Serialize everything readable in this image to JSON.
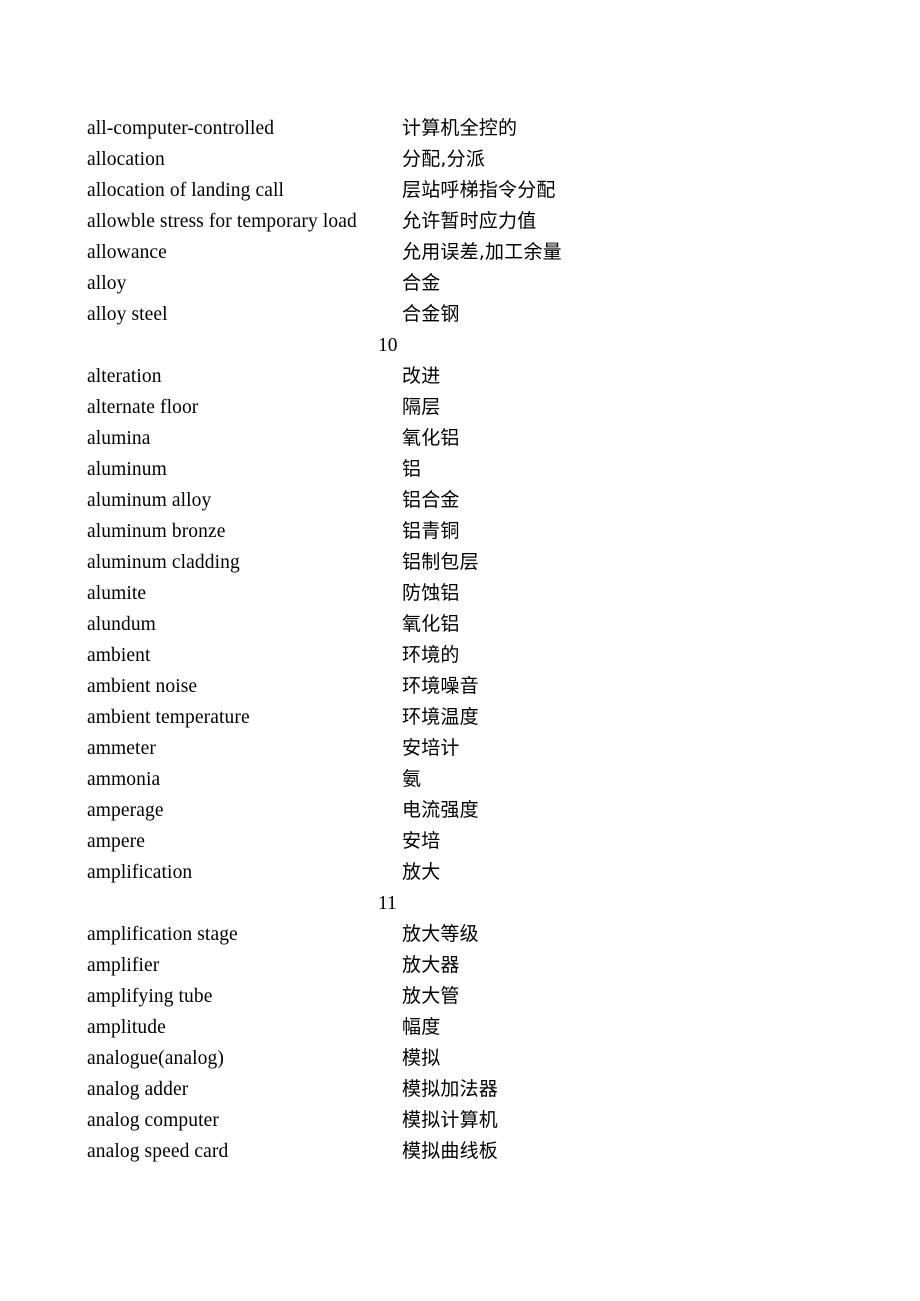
{
  "document": {
    "type": "bilingual-glossary",
    "language_pair": "English-Chinese",
    "column_headers_visible": false
  },
  "blocks": [
    {
      "entries": [
        {
          "term": "all-computer-controlled",
          "gloss": "计算机全控的"
        },
        {
          "term": "allocation",
          "gloss": "分配,分派"
        },
        {
          "term": "allocation of landing call",
          "gloss": "层站呼梯指令分配"
        },
        {
          "term": "allowble stress for temporary  load",
          "gloss": "允许暂时应力值"
        },
        {
          "term": "allowance",
          "gloss": "允用误差,加工余量"
        },
        {
          "term": "alloy",
          "gloss": "合金"
        },
        {
          "term": "alloy steel",
          "gloss": "合金钢"
        }
      ],
      "page_marker": "10"
    },
    {
      "entries": [
        {
          "term": "alteration",
          "gloss": "改进"
        },
        {
          "term": "alternate floor",
          "gloss": "隔层"
        },
        {
          "term": "alumina",
          "gloss": "氧化铝"
        },
        {
          "term": "aluminum",
          "gloss": "铝"
        },
        {
          "term": "aluminum alloy",
          "gloss": "铝合金"
        },
        {
          "term": "aluminum bronze",
          "gloss": "铝青铜"
        },
        {
          "term": "aluminum cladding",
          "gloss": "铝制包层"
        },
        {
          "term": "alumite",
          "gloss": "防蚀铝"
        },
        {
          "term": "alundum",
          "gloss": "氧化铝"
        },
        {
          "term": "ambient",
          "gloss": "环境的"
        },
        {
          "term": "ambient noise",
          "gloss": "环境噪音"
        },
        {
          "term": "ambient temperature",
          "gloss": "环境温度"
        },
        {
          "term": "ammeter",
          "gloss": "安培计"
        },
        {
          "term": "ammonia",
          "gloss": "氨"
        },
        {
          "term": "amperage",
          "gloss": "电流强度"
        },
        {
          "term": "ampere",
          "gloss": "安培"
        },
        {
          "term": "amplification",
          "gloss": "放大"
        }
      ],
      "page_marker": "11"
    },
    {
      "entries": [
        {
          "term": "amplification stage",
          "gloss": "放大等级"
        },
        {
          "term": "amplifier",
          "gloss": "放大器"
        },
        {
          "term": "amplifying tube",
          "gloss": "放大管"
        },
        {
          "term": "amplitude",
          "gloss": "幅度"
        },
        {
          "term": "analogue(analog)",
          "gloss": "模拟"
        },
        {
          "term": "analog adder",
          "gloss": "模拟加法器"
        },
        {
          "term": "analog computer",
          "gloss": "模拟计算机"
        },
        {
          "term": "analog speed card",
          "gloss": "模拟曲线板"
        }
      ],
      "page_marker": null
    }
  ]
}
